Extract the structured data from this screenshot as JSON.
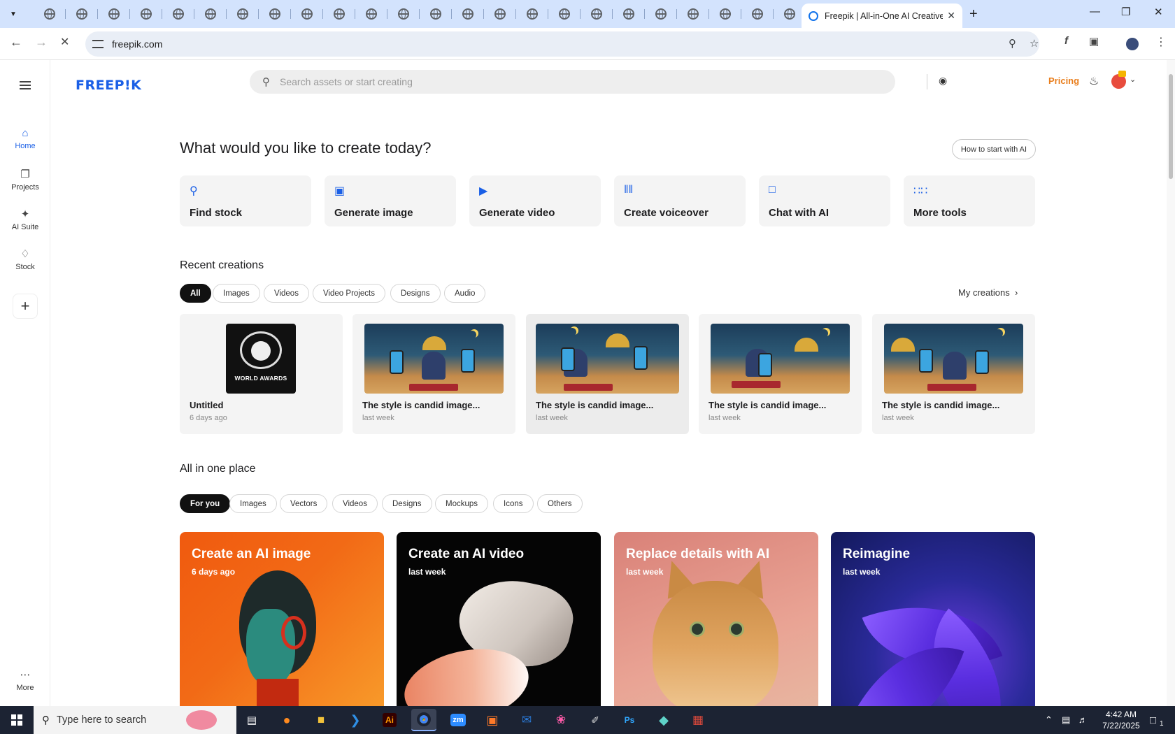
{
  "browser": {
    "active_tab_title": "Freepik | All-in-One AI Creative",
    "url": "freepik.com"
  },
  "site": {
    "logo": "FREEP!K",
    "search_placeholder": "Search assets or start creating",
    "pricing": "Pricing"
  },
  "rail": {
    "home": "Home",
    "projects": "Projects",
    "ai_suite": "AI Suite",
    "stock": "Stock",
    "more": "More"
  },
  "hero": {
    "heading": "What would you like to create today?",
    "how_to": "How to start with AI"
  },
  "quick_actions": [
    {
      "label": "Find stock",
      "icon": "search-icon"
    },
    {
      "label": "Generate image",
      "icon": "image-icon"
    },
    {
      "label": "Generate video",
      "icon": "video-icon"
    },
    {
      "label": "Create voiceover",
      "icon": "waveform-icon"
    },
    {
      "label": "Chat with AI",
      "icon": "chat-icon"
    },
    {
      "label": "More tools",
      "icon": "grid-icon"
    }
  ],
  "recent": {
    "heading": "Recent creations",
    "filters": [
      "All",
      "Images",
      "Videos",
      "Video Projects",
      "Designs",
      "Audio"
    ],
    "selected_filter": "All",
    "my_creations": "My creations",
    "items": [
      {
        "title": "Untitled",
        "date": "6 days ago",
        "thumb_text": "WORLD AWARDS"
      },
      {
        "title": "The style is candid image...",
        "date": "last week"
      },
      {
        "title": "The style is candid image...",
        "date": "last week"
      },
      {
        "title": "The style is candid image...",
        "date": "last week"
      },
      {
        "title": "The style is candid image...",
        "date": "last week"
      }
    ]
  },
  "all_in_one": {
    "heading": "All in one place",
    "filters": [
      "For you",
      "Images",
      "Vectors",
      "Videos",
      "Designs",
      "Mockups",
      "Icons",
      "Others"
    ],
    "selected_filter": "For you",
    "cards": [
      {
        "title": "Create an AI image",
        "date": "6 days ago"
      },
      {
        "title": "Create an AI video",
        "date": "last week"
      },
      {
        "title": "Replace details with AI",
        "date": "last week"
      },
      {
        "title": "Reimagine",
        "date": "last week"
      }
    ]
  },
  "taskbar": {
    "search_placeholder": "Type here to search",
    "time": "4:42 AM",
    "date": "7/22/2025",
    "notification_count": "1",
    "apps": [
      "Ai",
      "zm",
      "Ps"
    ]
  }
}
